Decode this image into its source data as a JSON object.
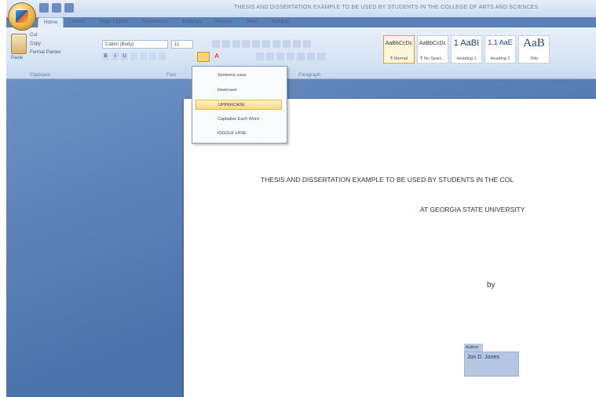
{
  "window": {
    "title": "THESIS AND DISSERTATION EXAMPLE TO BE USED BY STUDENTS IN THE COLLEGE OF ARTS AND SCIENCES"
  },
  "ribbon_tabs": [
    "Home",
    "Insert",
    "Page Layout",
    "References",
    "Mailings",
    "Review",
    "View",
    "Acrobat"
  ],
  "clipboard": {
    "paste_label": "Paste",
    "cut_label": "Cut",
    "copy_label": "Copy",
    "format_painter_label": "Format Painter",
    "group_label": "Clipboard"
  },
  "font": {
    "name": "Calibri (Body)",
    "size": "11",
    "group_label": "Font"
  },
  "paragraph": {
    "group_label": "Paragraph"
  },
  "styles": [
    {
      "sample": "AaBbCcDc",
      "name": "¶ Normal"
    },
    {
      "sample": "AaBbCcDc",
      "name": "¶ No Spaci..."
    },
    {
      "sample": "1 AaBI",
      "name": "Heading 1"
    },
    {
      "sample": "1.1 AaE",
      "name": "Heading 2"
    },
    {
      "sample": "AaB",
      "name": "Title"
    }
  ],
  "case_menu": {
    "items": [
      "Sentence case.",
      "lowercase",
      "UPPERCASE",
      "Capitalize Each Word",
      "tOGGLE cASE"
    ],
    "highlighted_index": 2
  },
  "document": {
    "line1": "THESIS AND DISSERTATION EXAMPLE TO BE USED BY STUDENTS IN THE COL",
    "line2": "AT GEORGIA STATE UNIVERSITY",
    "by": "by",
    "author_tag": "Author",
    "author_name": "Jon D. Jones"
  }
}
